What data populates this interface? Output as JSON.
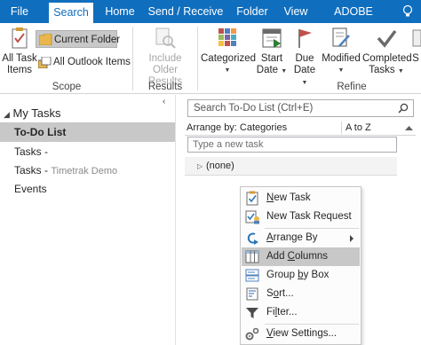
{
  "tabs": [
    {
      "label": "File",
      "active": false
    },
    {
      "label": "Search",
      "active": true
    },
    {
      "label": "Home",
      "active": false
    },
    {
      "label": "Send / Receive",
      "active": false
    },
    {
      "label": "Folder",
      "active": false
    },
    {
      "label": "View",
      "active": false
    },
    {
      "label": "ADOBE PDF",
      "active": false
    }
  ],
  "ribbon": {
    "scope": {
      "all_task_items_line1": "All Task",
      "all_task_items_line2": "Items",
      "current_folder": "Current Folder",
      "all_outlook_items": "All Outlook Items",
      "label": "Scope"
    },
    "results": {
      "include_line1": "Include",
      "include_line2": "Older Results",
      "label": "Results"
    },
    "refine": {
      "categorized": "Categorized",
      "start_line1": "Start",
      "start_line2": "Date",
      "due_line1": "Due",
      "due_line2": "Date",
      "modified": "Modified",
      "completed_line1": "Completed",
      "completed_line2": "Tasks",
      "overflow": "S",
      "label": "Refine"
    }
  },
  "nav": {
    "header": "My Tasks",
    "items": [
      {
        "label": "To-Do List",
        "sub": "",
        "selected": true
      },
      {
        "label": "Tasks -",
        "sub": "",
        "selected": false
      },
      {
        "label": "Tasks -",
        "sub": "Timetrak Demo",
        "selected": false
      },
      {
        "label": "Events",
        "sub": "",
        "selected": false
      }
    ]
  },
  "tasklist": {
    "search_placeholder": "Search To-Do List (Ctrl+E)",
    "arrange_by": "Arrange by: Categories",
    "sort_order": "A to Z",
    "new_task_placeholder": "Type a new task",
    "group_label": "(none)"
  },
  "context_menu": {
    "items": [
      {
        "id": "new-task",
        "label": "New Task",
        "accel": "N",
        "icon": "task-icon"
      },
      {
        "id": "new-task-request",
        "label": "New Task Request",
        "accel": "",
        "icon": "task-request-icon"
      },
      {
        "id": "arrange-by",
        "label": "Arrange By",
        "accel": "A",
        "icon": "arrange-icon",
        "submenu": true
      },
      {
        "id": "add-columns",
        "label": "Add Columns",
        "accel": "C",
        "icon": "columns-icon",
        "hover": true
      },
      {
        "id": "group-by-box",
        "label": "Group by Box",
        "accel": "b",
        "icon": "group-box-icon"
      },
      {
        "id": "sort",
        "label": "Sort...",
        "accel": "o",
        "icon": "sort-icon"
      },
      {
        "id": "filter",
        "label": "Filter...",
        "accel": "l",
        "icon": "filter-icon"
      },
      {
        "id": "view-settings",
        "label": "View Settings...",
        "accel": "V",
        "icon": "view-settings-icon"
      }
    ]
  },
  "colors": {
    "brand": "#106ebe",
    "selected": "#c8c8c8"
  }
}
